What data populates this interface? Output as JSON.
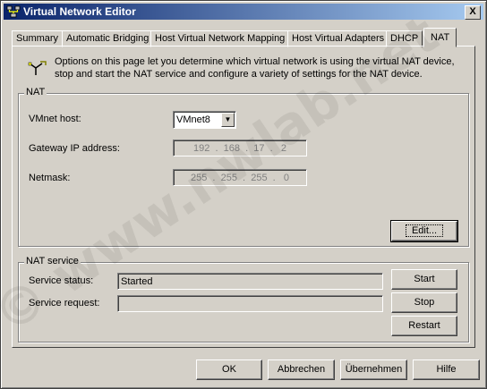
{
  "window": {
    "title": "Virtual Network Editor",
    "close_label": "X"
  },
  "tabs": [
    {
      "label": "Summary"
    },
    {
      "label": "Automatic Bridging"
    },
    {
      "label": "Host Virtual Network Mapping"
    },
    {
      "label": "Host Virtual Adapters"
    },
    {
      "label": "DHCP"
    },
    {
      "label": "NAT"
    }
  ],
  "info_text": "Options on this page let you determine which virtual network is using the virtual NAT device, stop and start the NAT service and configure a variety of settings for the NAT device.",
  "nat": {
    "group_label": "NAT",
    "vmnet_host_label": "VMnet host:",
    "vmnet_host_value": "VMnet8",
    "gateway_label": "Gateway IP address:",
    "gateway_value": "192  .  168  .  17  .   2",
    "netmask_label": "Netmask:",
    "netmask_value": "255  .  255  .  255  .   0",
    "edit_button": "Edit..."
  },
  "nat_service": {
    "group_label": "NAT service",
    "status_label": "Service status:",
    "status_value": "Started",
    "request_label": "Service request:",
    "request_value": "",
    "start_button": "Start",
    "stop_button": "Stop",
    "restart_button": "Restart"
  },
  "footer": {
    "ok": "OK",
    "cancel": "Abbrechen",
    "apply": "Übernehmen",
    "help": "Hilfe"
  },
  "watermark": "© www.nwlab.net"
}
